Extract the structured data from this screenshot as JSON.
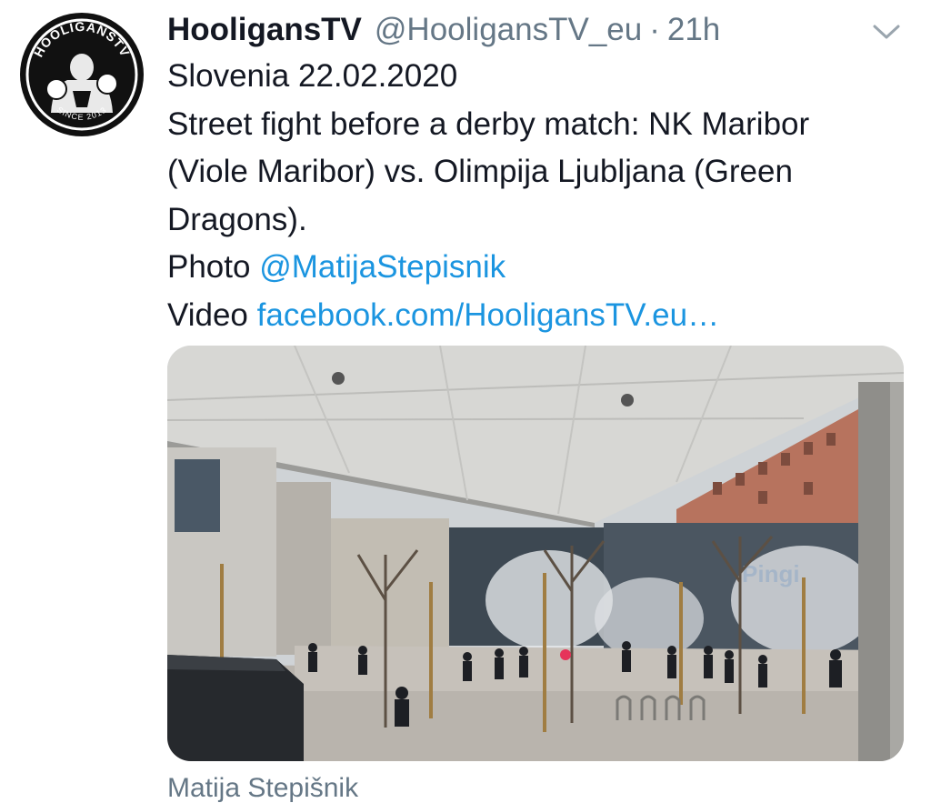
{
  "tweet": {
    "author_name": "HooligansTV",
    "author_handle": "@HooligansTV_eu",
    "separator": "·",
    "timestamp": "21h",
    "avatar_text_top": "HOOLIGANSTV",
    "avatar_text_bottom": "SINCE 2013",
    "lines": [
      "Slovenia 22.02.2020",
      "Street fight before a derby match: NK Maribor",
      "(Viole Maribor) vs. Olimpija Ljubljana (Green",
      "Dragons)."
    ],
    "photo_label": "Photo",
    "photo_mention": "@MatijaStepisnik",
    "video_label": "Video",
    "video_link": "facebook.com/HooligansTV.eu…",
    "media_credit": "Matija Stepišnik",
    "media_sign_text": "Pingi",
    "icons": {
      "menu": "chevron-down-icon",
      "avatar": "fighter-logo"
    },
    "colors": {
      "link": "#1b95e0",
      "secondary_text": "#657786",
      "primary_text": "#141823"
    }
  }
}
